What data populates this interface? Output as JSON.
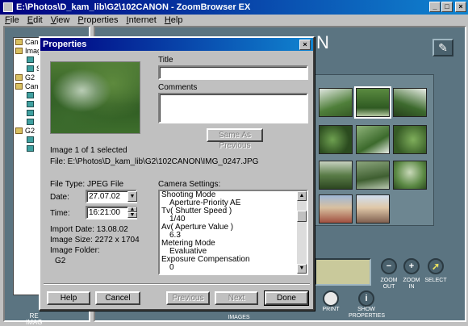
{
  "window": {
    "title": "E:\\Photos\\D_kam_lib\\G2\\102CANON - ZoomBrowser EX",
    "minimize": "_",
    "maximize": "□",
    "close": "×"
  },
  "menu": [
    "File",
    "Edit",
    "View",
    "Properties",
    "Internet",
    "Help"
  ],
  "tree": {
    "items": [
      {
        "label": "Canon",
        "level": 0
      },
      {
        "label": "Imag",
        "level": 0
      },
      {
        "label": "",
        "level": 1
      },
      {
        "label": "S",
        "level": 1
      },
      {
        "label": "G2",
        "level": 0
      },
      {
        "label": "Canon",
        "level": 0
      },
      {
        "label": "",
        "level": 1
      },
      {
        "label": "",
        "level": 1
      },
      {
        "label": "",
        "level": 1
      },
      {
        "label": "",
        "level": 1
      },
      {
        "label": "G2",
        "level": 0
      },
      {
        "label": "",
        "level": 1
      },
      {
        "label": "",
        "level": 1
      }
    ],
    "bottom_label": "RE\nIMAG"
  },
  "main": {
    "header_fragment": "N",
    "edit_icon": "✎",
    "zoom_out_label": "ZOOM\nOUT",
    "zoom_in_label": "ZOOM\nIN",
    "select_label": "SELECT",
    "print_label": "PRINT",
    "show_properties_label": "SHOW\nPROPERTIES",
    "bottom_fragment": "IMAGES"
  },
  "dialog": {
    "title": "Properties",
    "close": "×",
    "title_label": "Title",
    "title_value": "",
    "comments_label": "Comments",
    "comments_value": "",
    "same_as_previous": "Same As Previous",
    "selection_info": "Image 1 of 1 selected",
    "file_path": "File: E:\\Photos\\D_kam_lib\\G2\\102CANON\\IMG_0247.JPG",
    "file_type_label": "File Type:",
    "file_type_value": "JPEG File",
    "date_label": "Date:",
    "date_value": "27.07.02",
    "time_label": "Time:",
    "time_value": "16:21:00",
    "import_date": "Import Date: 13.08.02",
    "image_size": "Image Size:  2272 x 1704",
    "image_folder_label": "Image Folder:",
    "image_folder_value": "G2",
    "camera_settings_label": "Camera Settings:",
    "camera_settings": [
      {
        "text": "Shooting Mode",
        "indent": false
      },
      {
        "text": "Aperture-Priority AE",
        "indent": true
      },
      {
        "text": "Tv( Shutter Speed )",
        "indent": false
      },
      {
        "text": "1/40",
        "indent": true
      },
      {
        "text": "Av( Aperture Value )",
        "indent": false
      },
      {
        "text": "6.3",
        "indent": true
      },
      {
        "text": "Metering Mode",
        "indent": false
      },
      {
        "text": "Evaluative",
        "indent": true
      },
      {
        "text": "Exposure Compensation",
        "indent": false
      },
      {
        "text": "0",
        "indent": true
      }
    ],
    "buttons": {
      "help": "Help",
      "cancel": "Cancel",
      "previous": "Previous",
      "next": "Next",
      "done": "Done"
    }
  }
}
